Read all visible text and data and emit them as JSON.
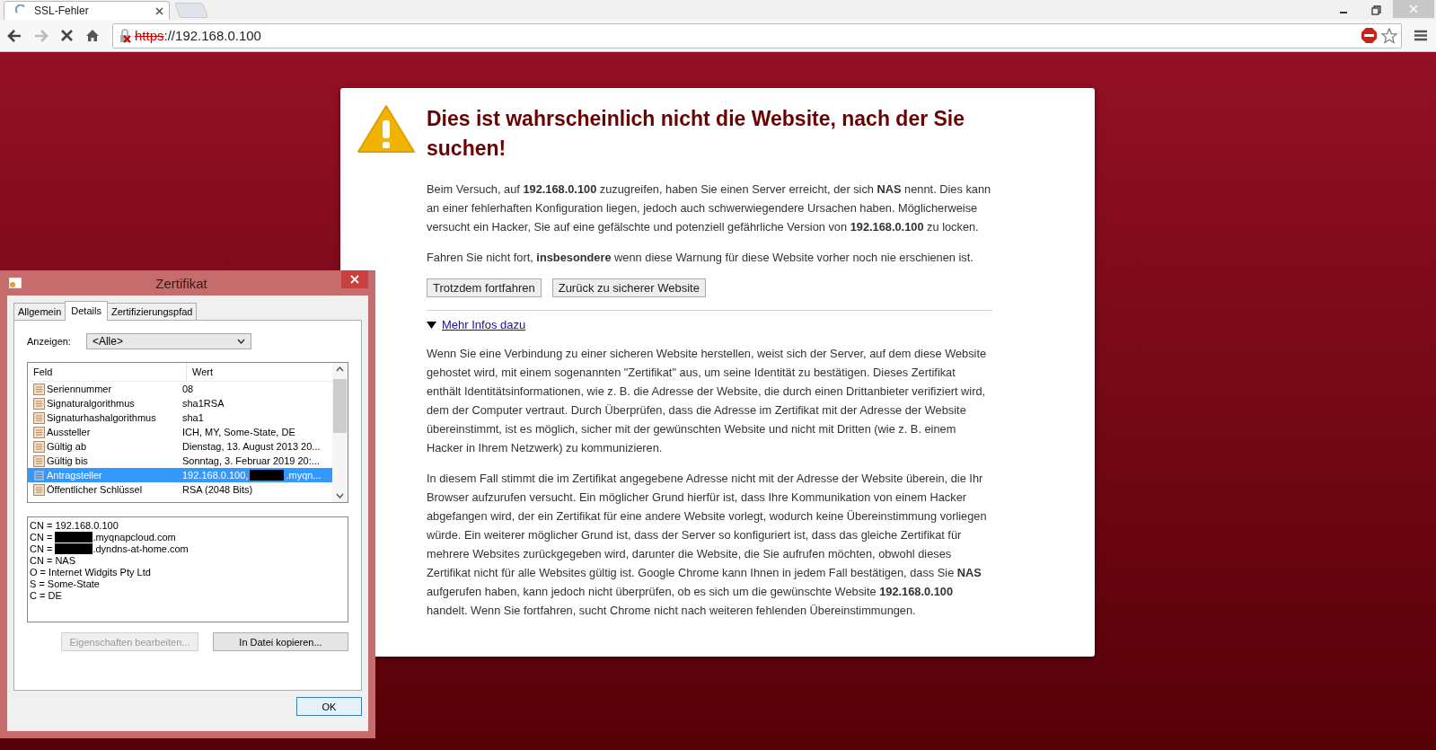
{
  "browser": {
    "tab_title": "SSL-Fehler",
    "url_scheme": "https",
    "url_rest": "://192.168.0.100"
  },
  "warning": {
    "title": "Dies ist wahrscheinlich nicht die Website, nach der Sie suchen!",
    "paragraphs": [
      "Beim Versuch, auf **192.168.0.100** zuzugreifen, haben Sie einen Server erreicht, der sich **NAS** nennt. Dies kann an einer fehlerhaften Konfiguration liegen, jedoch auch schwerwiegendere Ursachen haben. Möglicherweise versucht ein Hacker, Sie auf eine gefälschte und potenziell gefährliche Version von **192.168.0.100** zu locken.",
      "Fahren Sie nicht fort, **insbesondere** wenn diese Warnung für diese Website vorher noch nie erschienen ist."
    ],
    "buttons": [
      "Trotzdem fortfahren",
      "Zurück zu sicherer Website"
    ],
    "more_link": {
      "label": "Mehr Infos dazu",
      "expanded": true
    },
    "details": [
      "Wenn Sie eine Verbindung zu einer sicheren Website herstellen, weist sich der Server, auf dem diese Website gehostet wird, mit einem sogenannten \"Zertifikat\" aus, um seine Identität zu bestätigen. Dieses Zertifikat enthält Identitätsinformationen, wie z. B. die Adresse der Website, die durch einen Drittanbieter verifiziert wird, dem der Computer vertraut. Durch Überprüfen, dass die Adresse im Zertifikat mit der Adresse der Website übereinstimmt, ist es möglich, sicher mit der gewünschten Website und nicht mit Dritten (wie z. B. einem Hacker in Ihrem Netzwerk) zu kommunizieren.",
      "In diesem Fall stimmt die im Zertifikat angegebene Adresse nicht mit der Adresse der Website überein, die Ihr Browser aufzurufen versucht. Ein möglicher Grund hierfür ist, dass Ihre Kommunikation von einem Hacker abgefangen wird, der ein Zertifikat für eine andere Website vorlegt, wodurch keine Übereinstimmung vorliegen würde. Ein weiterer möglicher Grund ist, dass der Server so konfiguriert ist, dass das gleiche Zertifikat für mehrere Websites zurückgegeben wird, darunter die Website, die Sie aufrufen möchten, obwohl dieses Zertifikat nicht für alle Websites gültig ist. Google Chrome kann Ihnen in jedem Fall bestätigen, dass Sie **NAS** aufgerufen haben, kann jedoch nicht überprüfen, ob es sich um die gewünschte Website **192.168.0.100** handelt. Wenn Sie fortfahren, sucht Chrome nicht nach weiteren fehlenden Übereinstimmungen."
    ]
  },
  "dialog": {
    "title": "Zertifikat",
    "tabs": [
      {
        "label": "Allgemein",
        "selected": false
      },
      {
        "label": "Details",
        "selected": true
      },
      {
        "label": "Zertifizierungspfad",
        "selected": false
      }
    ],
    "show_label": "Anzeigen:",
    "show_value": "<Alle>",
    "columns": [
      "Feld",
      "Wert"
    ],
    "rows": [
      {
        "field": "Seriennummer",
        "value": "08",
        "redacted": false,
        "selected": false
      },
      {
        "field": "Signaturalgorithmus",
        "value": "sha1RSA",
        "redacted": false,
        "selected": false
      },
      {
        "field": "Signaturhashalgorithmus",
        "value": "sha1",
        "redacted": false,
        "selected": false
      },
      {
        "field": "Aussteller",
        "value": "ICH, MY, Some-State, DE",
        "redacted": false,
        "selected": false
      },
      {
        "field": "Gültig ab",
        "value": "Dienstag, 13. August 2013 20...",
        "redacted": false,
        "selected": false
      },
      {
        "field": "Gültig bis",
        "value": "Sonntag, 3. Februar 2019 20:...",
        "redacted": false,
        "selected": false
      },
      {
        "field": "Antragsteller",
        "value": "192.168.0.100,",
        "redacted": true,
        "value_after": ".myqn...",
        "selected": true
      },
      {
        "field": "Öffentlicher Schlüssel",
        "value": "RSA (2048 Bits)",
        "redacted": false,
        "selected": false
      }
    ],
    "detail_lines": [
      {
        "text": "CN = 192.168.0.100",
        "redacted": false
      },
      {
        "text": "CN =",
        "redacted": true,
        "after": ".myqnapcloud.com"
      },
      {
        "text": "CN =",
        "redacted": true,
        "after": ".dyndns-at-home.com"
      },
      {
        "text": "CN = NAS",
        "redacted": false
      },
      {
        "text": "O = Internet Widgits Pty Ltd",
        "redacted": false
      },
      {
        "text": "S = Some-State",
        "redacted": false
      },
      {
        "text": "C = DE",
        "redacted": false
      }
    ],
    "buttons": [
      {
        "label": "Eigenschaften bearbeiten...",
        "disabled": true
      },
      {
        "label": "In Datei kopieren...",
        "disabled": false
      }
    ],
    "ok": "OK"
  }
}
